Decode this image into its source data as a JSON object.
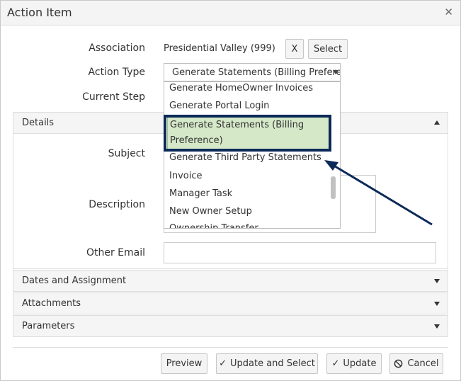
{
  "dialog": {
    "title": "Action Item"
  },
  "form": {
    "association_label": "Association",
    "association_value": "Presidential Valley (999)",
    "clear_label": "X",
    "select_label": "Select",
    "action_type_label": "Action Type",
    "action_type_value": "Generate Statements (Billing Preference)",
    "current_step_label": "Current Step"
  },
  "dropdown": {
    "options": [
      "Generate HomeOwner Invoices",
      "Generate Portal Login",
      "Generate Statements (Billing",
      "Preference)",
      "Generate Third Party Statements",
      "Invoice",
      "Manager Task",
      "New Owner Setup",
      "Ownership Transfer"
    ]
  },
  "details": {
    "title": "Details",
    "subject_label": "Subject",
    "description_label": "Description",
    "other_email_label": "Other Email"
  },
  "sections": {
    "dates": "Dates and Assignment",
    "attachments": "Attachments",
    "parameters": "Parameters"
  },
  "footer": {
    "preview": "Preview",
    "update_select": "Update and Select",
    "update": "Update",
    "cancel": "Cancel"
  },
  "colors": {
    "highlight_border": "#0c2a58",
    "selected_option_bg": "#d5e8c8"
  }
}
